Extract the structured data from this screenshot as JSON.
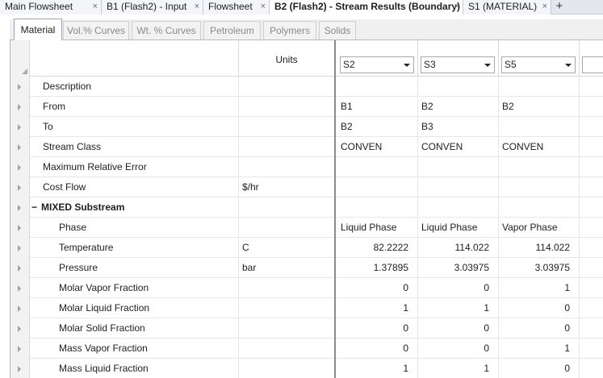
{
  "doc_tabs": [
    {
      "label": "Main Flowsheet",
      "close": "×"
    },
    {
      "label": "B1 (Flash2) - Input",
      "close": "×"
    },
    {
      "label": "Flowsheet",
      "close": "×"
    },
    {
      "label": "B2 (Flash2) - Stream Results (Boundary)",
      "close": "×"
    },
    {
      "label": "S1 (MATERIAL)",
      "close": "×"
    }
  ],
  "add_tab_glyph": "+",
  "sub_tabs": [
    "Material",
    "Vol.% Curves",
    "Wt. % Curves",
    "Petroleum",
    "Polymers",
    "Solids"
  ],
  "grid": {
    "units_header": "Units",
    "streams": [
      "S2",
      "S3",
      "S5",
      ""
    ],
    "rows": [
      {
        "label": "Description",
        "units": "",
        "values": [
          "",
          "",
          "",
          ""
        ]
      },
      {
        "label": "From",
        "units": "",
        "values": [
          "B1",
          "B2",
          "B2",
          ""
        ]
      },
      {
        "label": "To",
        "units": "",
        "values": [
          "B2",
          "B3",
          "",
          ""
        ]
      },
      {
        "label": "Stream Class",
        "units": "",
        "values": [
          "CONVEN",
          "CONVEN",
          "CONVEN",
          ""
        ]
      },
      {
        "label": "Maximum Relative Error",
        "units": "",
        "values": [
          "",
          "",
          "",
          ""
        ]
      },
      {
        "label": "Cost Flow",
        "units": "$/hr",
        "values": [
          "",
          "",
          "",
          ""
        ]
      },
      {
        "label": "MIXED Substream",
        "collapse": "−",
        "units": "",
        "values": [
          "",
          "",
          "",
          ""
        ]
      },
      {
        "label": "Phase",
        "units": "",
        "values": [
          "Liquid Phase",
          "Liquid Phase",
          "Vapor Phase",
          ""
        ]
      },
      {
        "label": "Temperature",
        "units": "C",
        "values": [
          "82.2222",
          "114.022",
          "114.022",
          ""
        ]
      },
      {
        "label": "Pressure",
        "units": "bar",
        "values": [
          "1.37895",
          "3.03975",
          "3.03975",
          ""
        ]
      },
      {
        "label": "Molar Vapor Fraction",
        "units": "",
        "values": [
          "0",
          "0",
          "1",
          ""
        ]
      },
      {
        "label": "Molar Liquid Fraction",
        "units": "",
        "values": [
          "1",
          "1",
          "0",
          ""
        ]
      },
      {
        "label": "Molar Solid Fraction",
        "units": "",
        "values": [
          "0",
          "0",
          "0",
          ""
        ]
      },
      {
        "label": "Mass Vapor Fraction",
        "units": "",
        "values": [
          "0",
          "0",
          "1",
          ""
        ]
      },
      {
        "label": "Mass Liquid Fraction",
        "units": "",
        "values": [
          "1",
          "1",
          "0",
          ""
        ]
      }
    ]
  },
  "colors": {
    "tab_strip": "#e4e8ee",
    "grid_header": "#f2f2f2",
    "active_tab_border": "#8ea6c4"
  }
}
